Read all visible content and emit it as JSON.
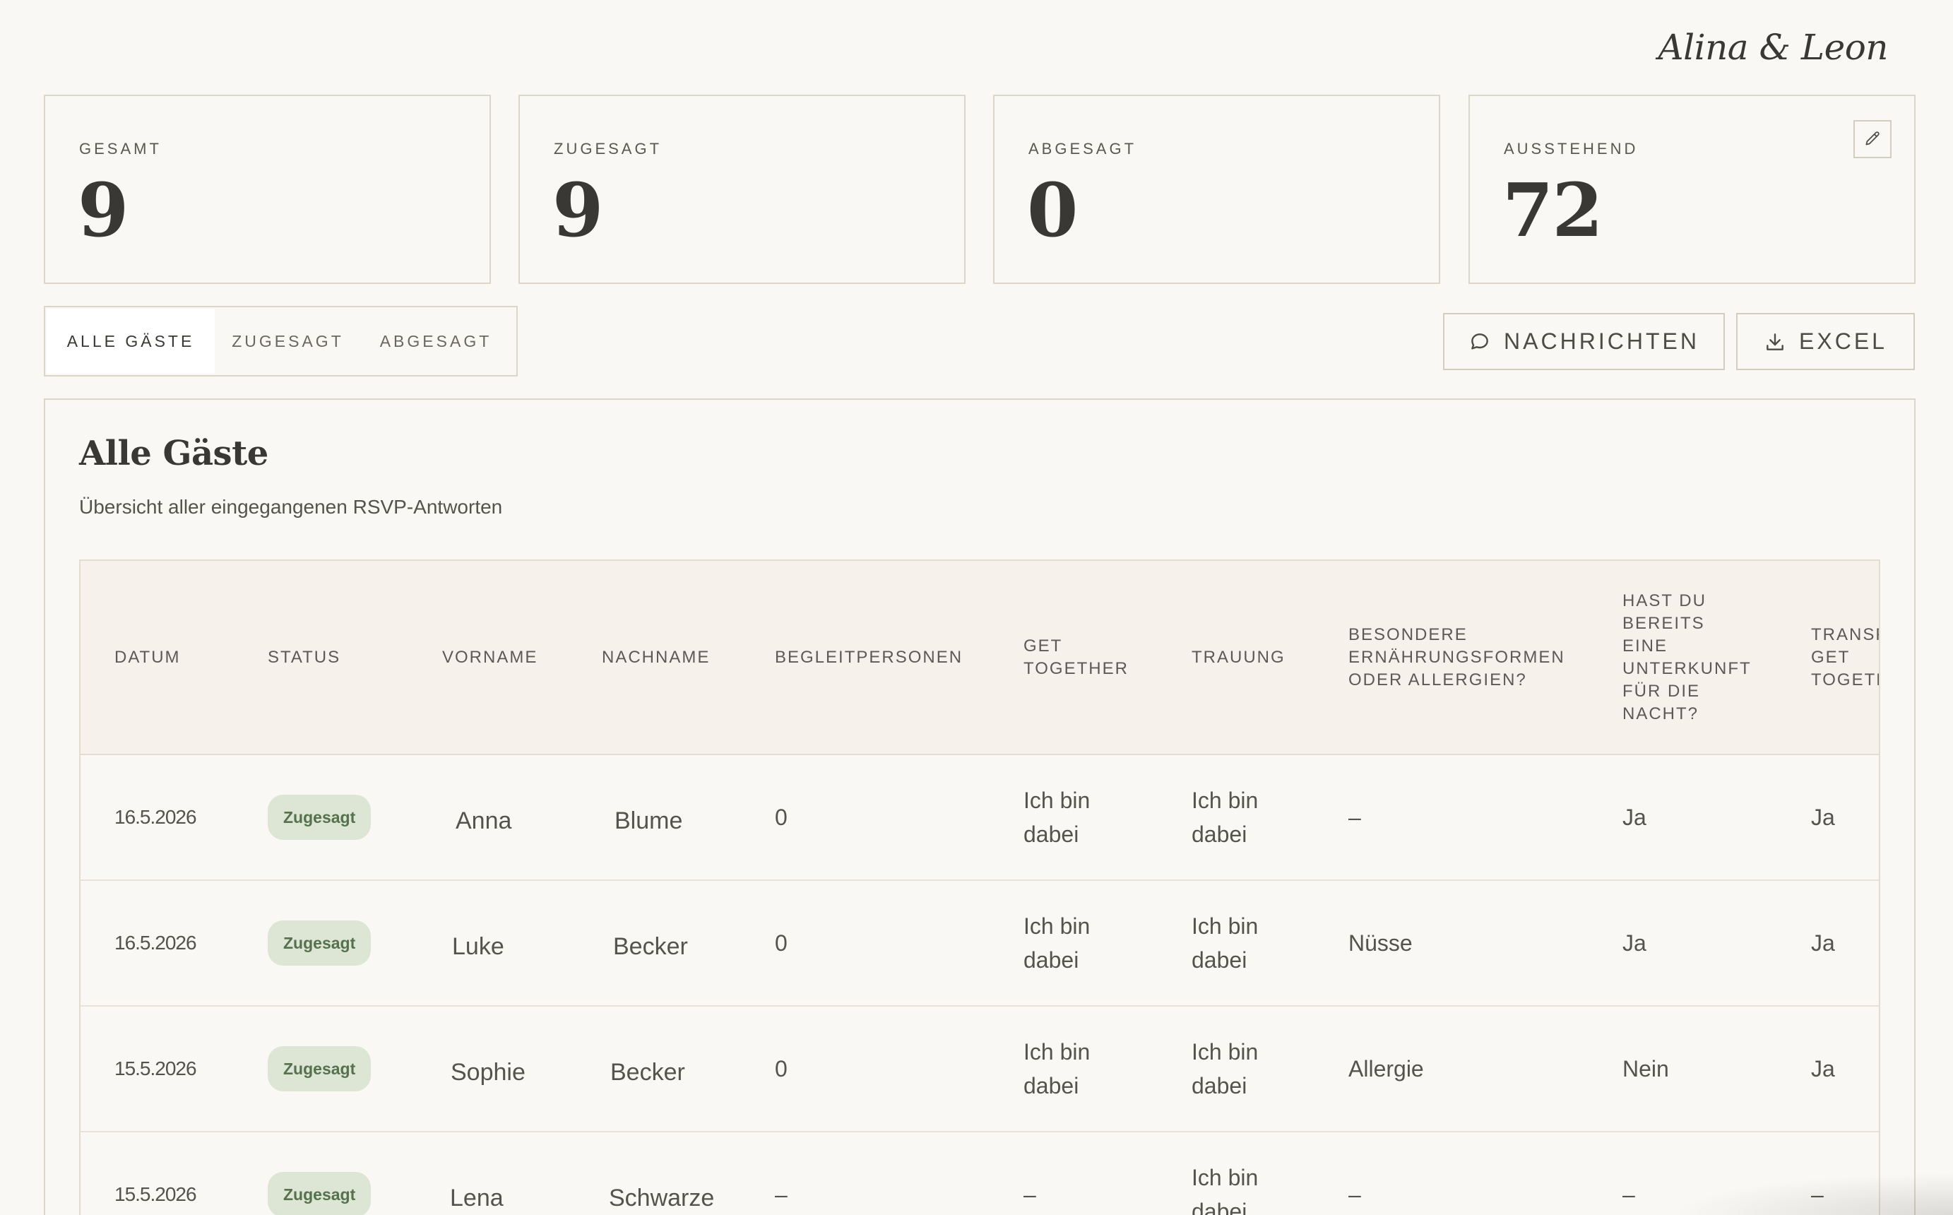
{
  "brand": "Alina & Leon",
  "stats": [
    {
      "label": "GESAMT",
      "value": "9"
    },
    {
      "label": "ZUGESAGT",
      "value": "9"
    },
    {
      "label": "ABGESAGT",
      "value": "0"
    },
    {
      "label": "AUSSTEHEND",
      "value": "72"
    }
  ],
  "filter_tabs": [
    {
      "label": "ALLE GÄSTE",
      "active": true
    },
    {
      "label": "ZUGESAGT",
      "active": false
    },
    {
      "label": "ABGESAGT",
      "active": false
    }
  ],
  "actions": {
    "messages_label": "NACHRICHTEN",
    "excel_label": "EXCEL"
  },
  "panel": {
    "title": "Alle Gäste",
    "subtitle": "Übersicht aller eingegangenen RSVP-Antworten"
  },
  "table": {
    "headers": [
      "DATUM",
      "STATUS",
      "VORNAME",
      "NACHNAME",
      "BEGLEITPERSONEN",
      "GET TOGETHER",
      "TRAUUNG",
      "BESONDERE ERNÄHRUNGSFORMEN ODER ALLERGIEN?",
      "HAST DU BEREITS EINE UNTERKUNFT FÜR DIE NACHT?",
      "TRANSFER GET TOGETHER"
    ],
    "rows": [
      [
        "16.5.2026",
        "Zugesagt",
        "Anna",
        "Blume",
        "0",
        "Ich bin dabei",
        "Ich bin dabei",
        "–",
        "Ja",
        "Ja"
      ],
      [
        "16.5.2026",
        "Zugesagt",
        "Luke",
        "Becker",
        "0",
        "Ich bin dabei",
        "Ich bin dabei",
        "Nüsse",
        "Ja",
        "Ja"
      ],
      [
        "15.5.2026",
        "Zugesagt",
        "Sophie",
        "Becker",
        "0",
        "Ich bin dabei",
        "Ich bin dabei",
        "Allergie",
        "Nein",
        "Ja"
      ],
      [
        "15.5.2026",
        "Zugesagt",
        "Lena",
        "Schwarze",
        "–",
        "–",
        "Ich bin dabei",
        "–",
        "–",
        "–"
      ]
    ]
  },
  "colors": {
    "background": "#faf8f4",
    "border": "#dcd5c9",
    "header_bg": "#f6f1eb",
    "badge_bg": "#dde6d4",
    "badge_text": "#55714d"
  },
  "icons": {
    "edit": "pencil-icon",
    "messages": "speech-bubble-icon",
    "excel": "download-icon"
  }
}
